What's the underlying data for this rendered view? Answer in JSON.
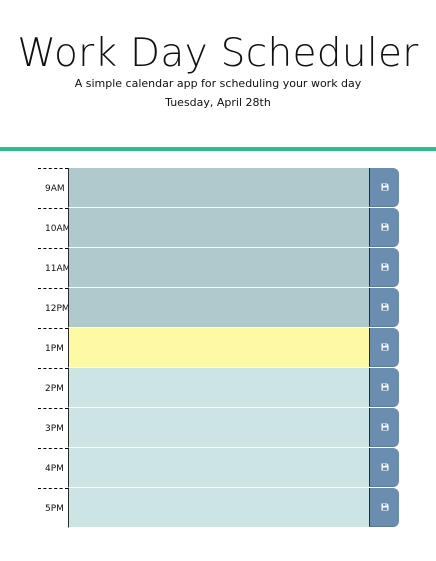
{
  "header": {
    "title": "Work Day Scheduler",
    "lead": "A simple calendar app for scheduling your work day",
    "current_day": "Tuesday, April 28th"
  },
  "colors": {
    "accent_divider": "#2fbe8a",
    "past": "#b0c9cd",
    "present": "#fef9a5",
    "future": "#cde4e5",
    "save_button": "#6b8db0"
  },
  "rows": [
    {
      "hour": "9AM",
      "status": "past",
      "text": ""
    },
    {
      "hour": "10AM",
      "status": "past",
      "text": ""
    },
    {
      "hour": "11AM",
      "status": "past",
      "text": ""
    },
    {
      "hour": "12PM",
      "status": "past",
      "text": ""
    },
    {
      "hour": "1PM",
      "status": "present",
      "text": ""
    },
    {
      "hour": "2PM",
      "status": "future",
      "text": ""
    },
    {
      "hour": "3PM",
      "status": "future",
      "text": ""
    },
    {
      "hour": "4PM",
      "status": "future",
      "text": ""
    },
    {
      "hour": "5PM",
      "status": "future",
      "text": ""
    }
  ],
  "save_icon": "floppy-disk-icon"
}
